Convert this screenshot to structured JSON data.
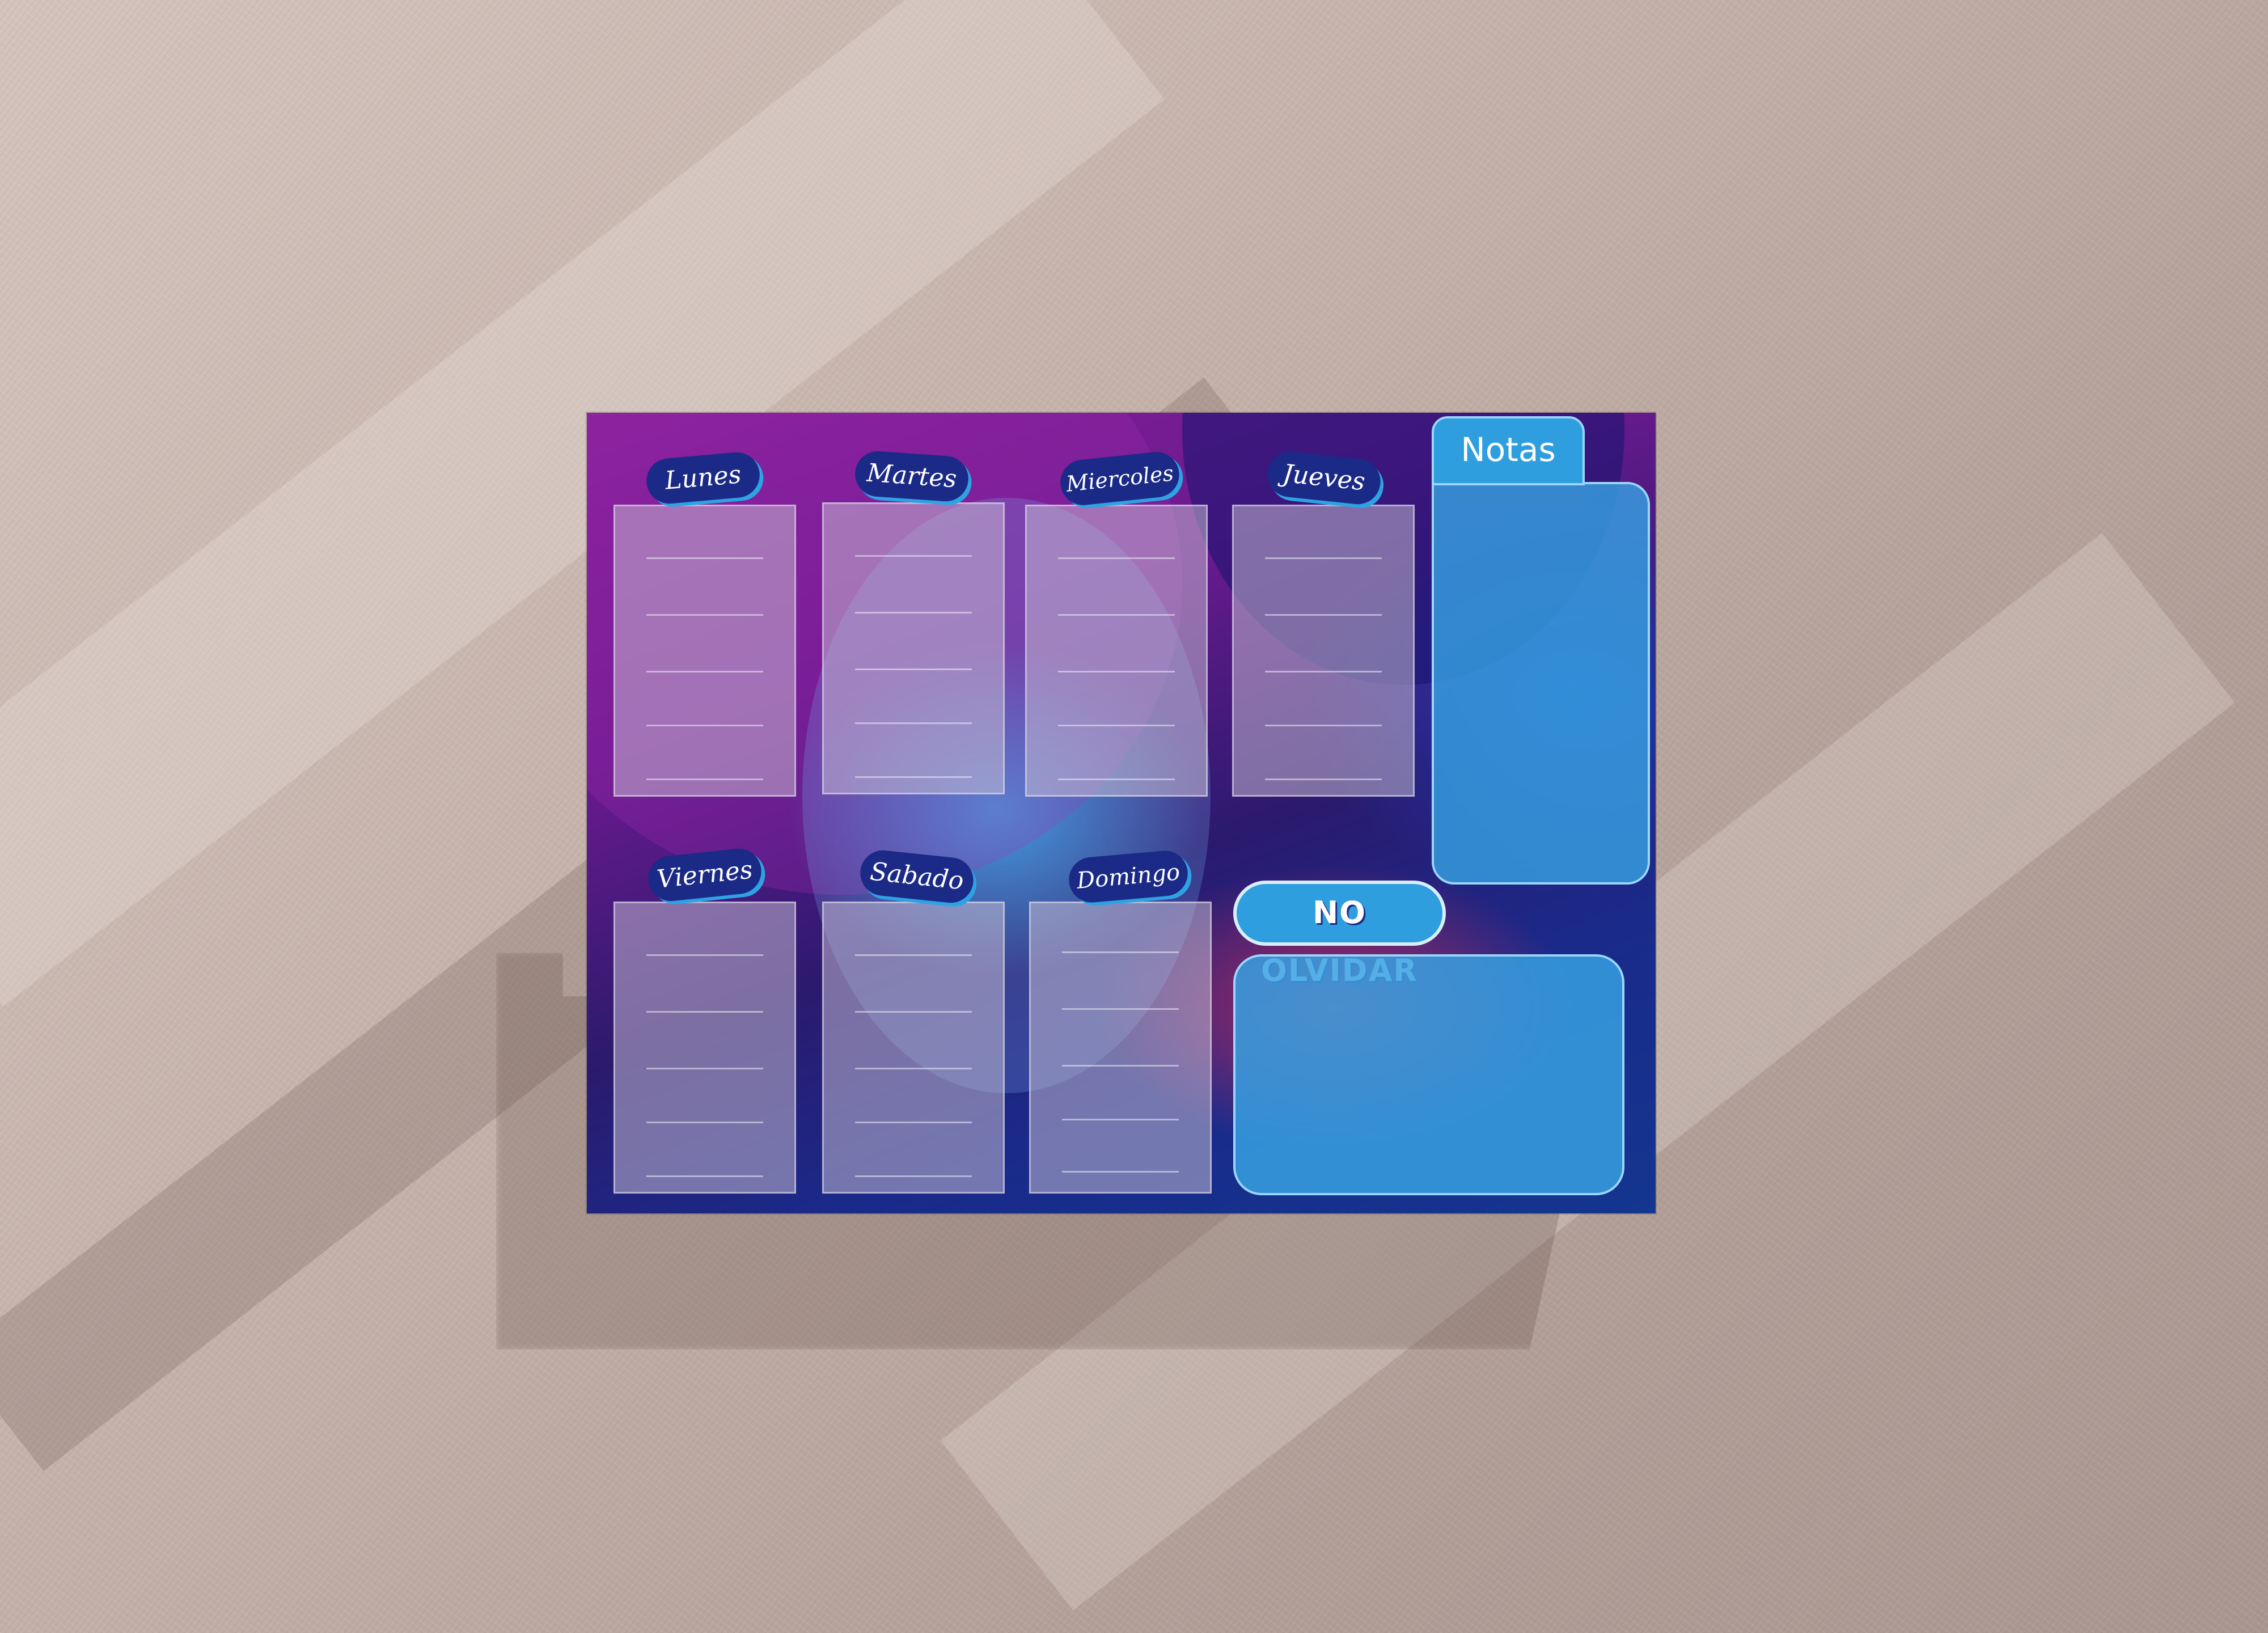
{
  "board": {
    "days": [
      {
        "label": "Lunes"
      },
      {
        "label": "Martes"
      },
      {
        "label": "Miercoles"
      },
      {
        "label": "Jueves"
      },
      {
        "label": "Viernes"
      },
      {
        "label": "Sabado"
      },
      {
        "label": "Domingo"
      }
    ],
    "notes_label": "Notas",
    "reminder_label": "NO OLVIDAR"
  },
  "colors": {
    "tab_fill": "#1b2a86",
    "tab_accent": "#2ea3e3",
    "panel_fill": "#37a0e1",
    "board_magenta": "#8a1f9a",
    "board_navy": "#13368f"
  }
}
